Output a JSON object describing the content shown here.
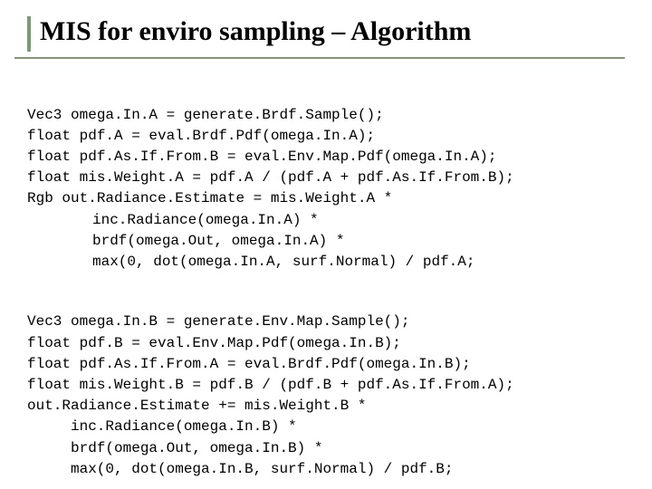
{
  "title": "MIS for enviro sampling – Algorithm",
  "code": {
    "a1": "Vec3 omega.In.A = generate.Brdf.Sample();",
    "a2": "float pdf.A = eval.Brdf.Pdf(omega.In.A);",
    "a3": "float pdf.As.If.From.B = eval.Env.Map.Pdf(omega.In.A);",
    "a4": "float mis.Weight.A = pdf.A / (pdf.A + pdf.As.If.From.B);",
    "a5": "Rgb out.Radiance.Estimate = mis.Weight.A *",
    "a6": "inc.Radiance(omega.In.A) *",
    "a7": "brdf(omega.Out, omega.In.A) *",
    "a8": "max(0, dot(omega.In.A, surf.Normal) / pdf.A;",
    "b1": "Vec3 omega.In.B = generate.Env.Map.Sample();",
    "b2": "float pdf.B = eval.Env.Map.Pdf(omega.In.B);",
    "b3": "float pdf.As.If.From.A = eval.Brdf.Pdf(omega.In.B);",
    "b4": "float mis.Weight.B = pdf.B / (pdf.B + pdf.As.If.From.A);",
    "b5": "out.Radiance.Estimate += mis.Weight.B *",
    "b6": "inc.Radiance(omega.In.B) *",
    "b7": "brdf(omega.Out, omega.In.B) *",
    "b8": "max(0, dot(omega.In.B, surf.Normal) / pdf.B;"
  }
}
